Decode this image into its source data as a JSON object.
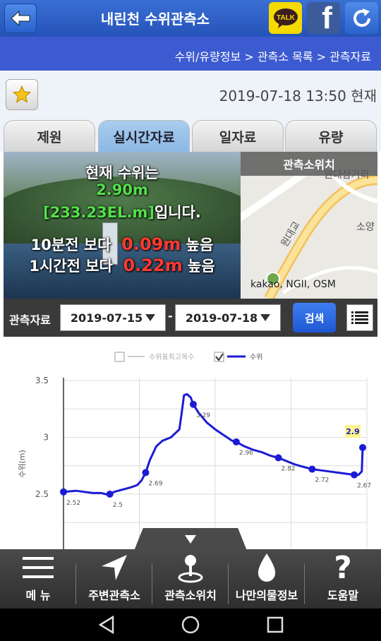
{
  "header": {
    "title": "내린천 수위관측소",
    "back_icon": "arrow-left-icon",
    "kakaotalk_label": "TALK",
    "facebook_label": "f",
    "refresh_icon": "refresh-icon"
  },
  "breadcrumb": "수위/유량정보 > 관측소 목록 > 관측자료",
  "info": {
    "favorite_icon": "star-icon",
    "datetime": "2019-07-18  13:50 현재"
  },
  "tabs": [
    {
      "label": "제원",
      "active": false
    },
    {
      "label": "실시간자료",
      "active": true
    },
    {
      "label": "일자료",
      "active": false
    },
    {
      "label": "유량",
      "active": false
    }
  ],
  "status": {
    "line1": "현재 수위는",
    "level": "2.90m",
    "elevation": "[233.23EL.m]",
    "elevation_suffix": "입니다.",
    "prev10_prefix": "10분전 보다",
    "prev10_value": "0.09m",
    "prev10_suffix": "높음",
    "prev1h_prefix": "1시간전 보다",
    "prev1h_value": "0.22m",
    "prev1h_suffix": "높음"
  },
  "map": {
    "header": "관측소위치",
    "labels": [
      "원대삼거리",
      "소양",
      "원대교"
    ],
    "attribution": "kakao, NGII, OSM"
  },
  "search": {
    "label": "관측자료",
    "start_date": "2019-07-15",
    "end_date": "2019-07-18",
    "separator": "-",
    "button": "검색",
    "list_icon": "list-icon"
  },
  "chart_data": {
    "type": "line",
    "legend": [
      {
        "name": "수위표최고목수",
        "checked": false,
        "color": "#cccccc"
      },
      {
        "name": "수위",
        "checked": true,
        "color": "#1b1bd6"
      }
    ],
    "ylabel": "수위(m)",
    "yticks": [
      "3.5",
      "3",
      "2.5"
    ],
    "ylim": [
      2.3,
      3.5
    ],
    "series": [
      {
        "name": "수위",
        "points": [
          [
            0,
            2.52
          ],
          [
            3,
            2.53
          ],
          [
            5,
            2.52
          ],
          [
            7,
            2.51
          ],
          [
            9,
            2.51
          ],
          [
            10,
            2.5
          ],
          [
            11,
            2.5
          ],
          [
            12,
            2.52
          ],
          [
            14,
            2.54
          ],
          [
            16,
            2.56
          ],
          [
            17.5,
            2.58
          ],
          [
            18.5,
            2.62
          ],
          [
            19.5,
            2.69
          ],
          [
            20.5,
            2.8
          ],
          [
            22,
            2.92
          ],
          [
            23.5,
            2.97
          ],
          [
            25.5,
            3.0
          ],
          [
            27.5,
            3.07
          ],
          [
            28,
            3.2
          ],
          [
            28.6,
            3.37
          ],
          [
            29.3,
            3.38
          ],
          [
            30.2,
            3.35
          ],
          [
            30.8,
            3.29
          ],
          [
            32,
            3.22
          ],
          [
            34,
            3.13
          ],
          [
            36,
            3.07
          ],
          [
            38,
            3.02
          ],
          [
            40,
            2.97
          ],
          [
            41,
            2.96
          ],
          [
            43,
            2.92
          ],
          [
            45,
            2.89
          ],
          [
            47,
            2.87
          ],
          [
            49,
            2.84
          ],
          [
            51,
            2.82
          ],
          [
            53,
            2.79
          ],
          [
            55,
            2.76
          ],
          [
            57,
            2.74
          ],
          [
            59,
            2.72
          ],
          [
            61,
            2.71
          ],
          [
            63,
            2.7
          ],
          [
            65,
            2.69
          ],
          [
            67,
            2.68
          ],
          [
            69,
            2.67
          ],
          [
            70,
            2.67
          ],
          [
            70.8,
            2.7
          ],
          [
            71,
            2.91
          ]
        ],
        "labeled_points": [
          {
            "x": 0,
            "y": 2.52,
            "label": "2.52"
          },
          {
            "x": 11,
            "y": 2.5,
            "label": "2.5"
          },
          {
            "x": 19.5,
            "y": 2.69,
            "label": "2.69"
          },
          {
            "x": 30.8,
            "y": 3.29,
            "label": "3.29"
          },
          {
            "x": 41,
            "y": 2.96,
            "label": "2.96"
          },
          {
            "x": 51,
            "y": 2.82,
            "label": "2.82"
          },
          {
            "x": 59,
            "y": 2.72,
            "label": "2.72"
          },
          {
            "x": 69,
            "y": 2.67,
            "label": "2.67"
          },
          {
            "x": 71,
            "y": 2.91,
            "label": "2.9",
            "highlight": true
          }
        ]
      }
    ],
    "grid": true
  },
  "menu": [
    {
      "label": "메 뉴",
      "icon": "hamburger-menu-icon"
    },
    {
      "label": "주변관측소",
      "icon": "navigation-arrow-icon"
    },
    {
      "label": "관측소위치",
      "icon": "map-pin-icon"
    },
    {
      "label": "나만의물정보",
      "icon": "water-drop-icon"
    },
    {
      "label": "도움말",
      "icon": "question-mark-icon"
    }
  ],
  "android_nav": [
    "back-icon",
    "home-icon",
    "recents-icon"
  ],
  "expand_icon": "triangle-down-icon"
}
